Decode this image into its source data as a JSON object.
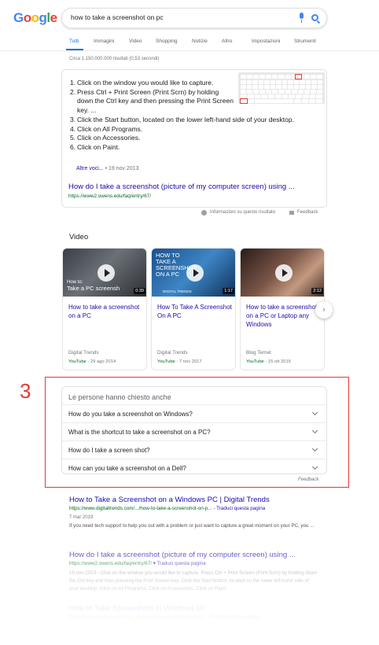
{
  "logo": {
    "text": "Google",
    "letters": [
      "G",
      "o",
      "o",
      "g",
      "l",
      "e"
    ]
  },
  "search": {
    "query": "how to take a screenshot on pc"
  },
  "tabs": [
    "Tutti",
    "Immagini",
    "Video",
    "Shopping",
    "Notizie",
    "Altro",
    "Impostazioni",
    "Strumenti"
  ],
  "stats": "Circa 1.150.000.000 risultati (0,53 secondi)",
  "snippet": {
    "steps": [
      "Click on the window you would like to capture.",
      "Press Ctrl + Print Screen (Print Scrn) by holding down the Ctrl key and then pressing the Print Screen key. ...",
      "Click the Start button, located on the lower left-hand side of your desktop.",
      "Click on All Programs.",
      "Click on Accessories.",
      "Click on Paint."
    ],
    "step_numbers": [
      "1.",
      "2.",
      "3.",
      "4.",
      "5.",
      "6."
    ],
    "more_label": "Altre voci...",
    "more_date": " • 19 nov 2013",
    "title": "How do I take a screenshot (picture of my computer screen) using ...",
    "url": "https://www2.owens.edu/faq/entry/67/"
  },
  "snippet_footer": {
    "info_label": "Informazioni su questo risultato",
    "feedback_label": "Feedback"
  },
  "videos": {
    "heading": "Video",
    "items": [
      {
        "title": "How to take a screenshot on a PC",
        "overlay": "How to:",
        "overlay_big": "Take a PC screensh",
        "duration": "0:39",
        "source": "Digital Trends",
        "platform": "YouTube",
        "date": " - 29 ago 2014"
      },
      {
        "title": "How To Take A Screenshot On A PC",
        "overlay": "HOW TO TAKE A SCREENSHOT ON A PC",
        "overlay_big": "",
        "duration": "1:17",
        "source": "Digital Trends",
        "platform": "YouTube",
        "date": " - 7 nov 2017"
      },
      {
        "title": "How to take a screenshot on a PC or Laptop any Windows",
        "overlay": "",
        "overlay_big": "",
        "duration": "2:12",
        "source": "Blog Ternet",
        "platform": "YouTube",
        "date": " - 15 ott 2015"
      }
    ],
    "brand_tag": "DIGITAL TRENDS"
  },
  "annotation": {
    "number": "3"
  },
  "paa": {
    "heading": "Le persone hanno chiesto anche",
    "questions": [
      "How do you take a screenshot on Windows?",
      "What is the shortcut to take a screenshot on a PC?",
      "How do I take a screen shot?",
      "How can you take a screenshot on a Dell?"
    ],
    "feedback": "Feedback"
  },
  "results": [
    {
      "title": "How to Take a Screenshot on a Windows PC | Digital Trends",
      "url": "https://www.digitaltrends.com/.../how-to-take-a-screenshot-on-p...",
      "translate": " - Traduci questa pagina",
      "date": "7 mar 2019",
      "desc": "If you need tech support to help you out with a problem or just want to capture a great moment on your PC, you ..."
    },
    {
      "title": "How do I take a screenshot (picture of my computer screen) using ...",
      "url": "https://www2.owens.edu/faq/entry/67/",
      "translate": " ▾ Traduci questa pagina",
      "date": "",
      "desc": "19 nov 2013 - Click on the window you would like to capture. Press Ctrl + Print Screen (Print Scrn) by holding down the Ctrl key and then pressing the Print Screen key. Click the Start button, located on the lower left-hand side of your desktop. Click on All Programs. Click on Accessories. Click on Paint."
    },
    {
      "title": "How to Take Screenshots in Windows 10",
      "url": "https://www.howtogeek.com/.../how-to-take-screenshots-in-w...",
      "translate": " - Traduci questa pagina",
      "date": "",
      "desc": ""
    }
  ],
  "colors": {
    "link": "#1a0dab",
    "url": "#006621",
    "accent": "#1a73e8",
    "annotation": "#e53935"
  }
}
